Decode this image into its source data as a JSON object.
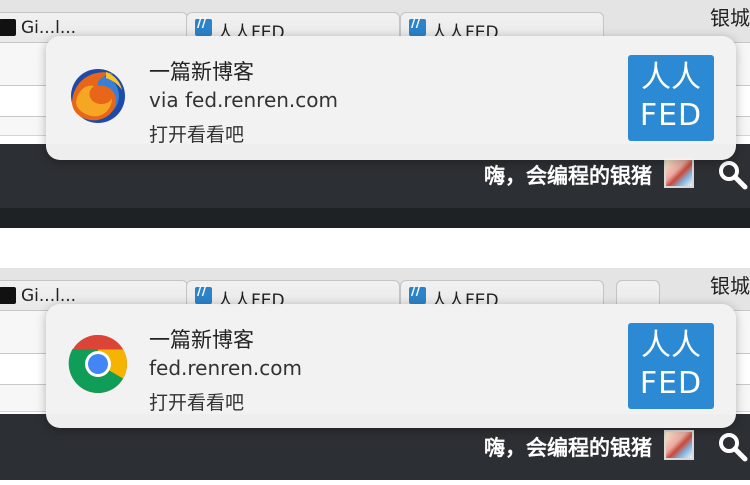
{
  "window": {
    "title_fragment": "银城"
  },
  "tabs": [
    {
      "title": "Gi...l..."
    },
    {
      "title": "人人FED"
    },
    {
      "title": "人人FED"
    }
  ],
  "site": {
    "greeting": "嗨，会编程的银猪",
    "search_icon": "search-icon",
    "accent": "#2b8ad3"
  },
  "notifications": {
    "firefox": {
      "app_icon": "firefox-icon",
      "title": "一篇新博客",
      "source": "via fed.renren.com",
      "action": "打开看看吧"
    },
    "chrome": {
      "app_icon": "chrome-icon",
      "title": "一篇新博客",
      "source": "fed.renren.com",
      "action": "打开看看吧"
    },
    "logo": {
      "line1": "人人",
      "line2": "FED"
    }
  }
}
